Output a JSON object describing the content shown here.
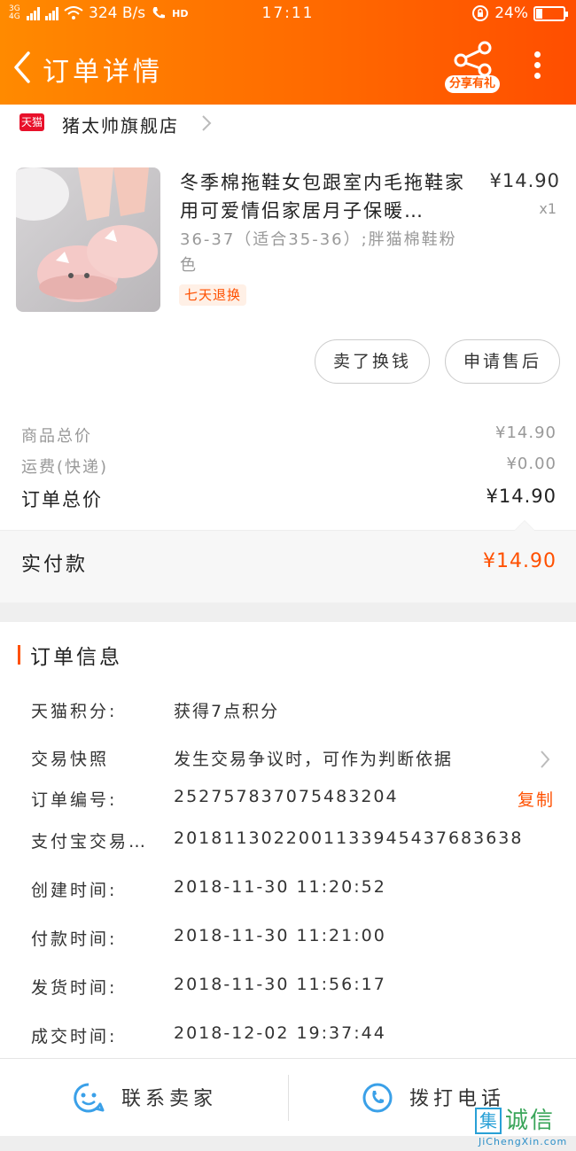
{
  "status_bar": {
    "network": "3G 4G",
    "speed": "324 B/s",
    "call": "HD",
    "time": "17:11",
    "battery": "24%",
    "battery_level": 0.24
  },
  "nav": {
    "title": "订单详情",
    "share_label": "分享有礼"
  },
  "shop": {
    "badge": "天猫",
    "name": "猪太帅旗舰店"
  },
  "product": {
    "title": "冬季棉拖鞋女包跟室内毛拖鞋家用可爱情侣家居月子保暖…",
    "price": "¥14.90",
    "qty": "x1",
    "sku": "36-37（适合35-36）;胖猫棉鞋粉色",
    "tag": "七天退换"
  },
  "actions": {
    "sell_label": "卖了换钱",
    "after_sale_label": "申请售后"
  },
  "summary": {
    "goods_total_label": "商品总价",
    "goods_total": "¥14.90",
    "shipping_label": "运费(快递)",
    "shipping": "¥0.00",
    "order_total_label": "订单总价",
    "order_total": "¥14.90",
    "paid_label": "实付款",
    "paid": "¥14.90"
  },
  "order_info": {
    "title": "订单信息",
    "rows": [
      {
        "label": "天猫积分:",
        "value": "获得7点积分"
      },
      {
        "label": "交易快照",
        "value": "发生交易争议时，可作为判断依据"
      },
      {
        "label": "订单编号:",
        "value": "252757837075483204",
        "action": "复制"
      },
      {
        "label": "支付宝交易…",
        "value": "2018113022001133945437683638"
      },
      {
        "label": "创建时间:",
        "value": "2018-11-30 11:20:52"
      },
      {
        "label": "付款时间:",
        "value": "2018-11-30 11:21:00"
      },
      {
        "label": "发货时间:",
        "value": "2018-11-30 11:56:17"
      },
      {
        "label": "成交时间:",
        "value": "2018-12-02 19:37:44"
      }
    ]
  },
  "bottom": {
    "contact_label": "联系卖家",
    "call_label": "拨打电话"
  },
  "watermark": {
    "box": "集",
    "text": "诚信",
    "url": "JiChengXin.com"
  },
  "colors": {
    "accent": "#ff5000",
    "header_start": "#ff8a00",
    "header_end": "#ff4e00",
    "icon_blue": "#3aa0e8"
  }
}
